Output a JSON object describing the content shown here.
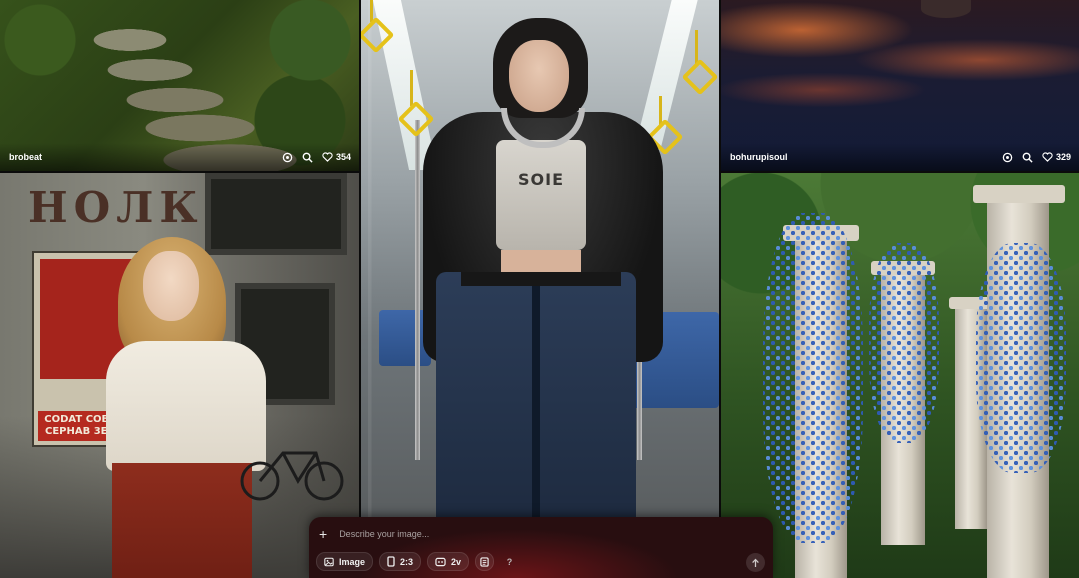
{
  "gallery": {
    "tiles": [
      {
        "id": "forest",
        "author": "brobeat",
        "likes": "354"
      },
      {
        "id": "soviet-girl"
      },
      {
        "id": "subway-girl"
      },
      {
        "id": "sunset-sky",
        "author": "bohurupisoul",
        "likes": "329"
      },
      {
        "id": "wisteria-columns"
      }
    ]
  },
  "artwork_text": {
    "wall_sign": "НОЛК",
    "poster_caption": "CODAT COBECH\nCEPHAB 3EPOB",
    "tee_print": "SOIE"
  },
  "prompt_bar": {
    "placeholder": "Describe your image...",
    "mode_label": "Image",
    "aspect_label": "2:3",
    "version_label": "2v",
    "help_label": "?"
  },
  "icons": {
    "remix": "remix-icon",
    "search": "search-icon",
    "like": "heart-icon",
    "add": "plus-icon",
    "image": "image-icon",
    "aspect": "aspect-ratio-icon",
    "version": "model-icon",
    "style": "style-icon",
    "send": "arrow-up-icon"
  },
  "colors": {
    "accent_bar": "#1d1414",
    "chip_text": "#f0f0f0",
    "wisteria": "#3f6fd0",
    "handle_yellow": "#e5c21a"
  }
}
